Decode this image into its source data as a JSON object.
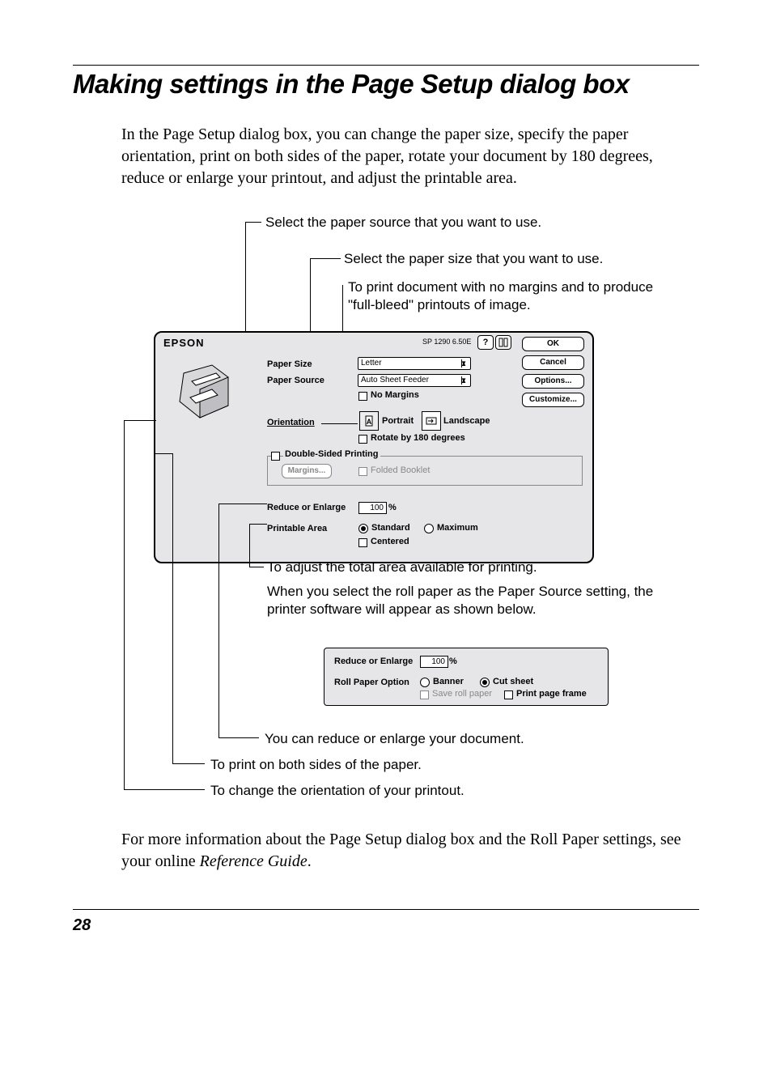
{
  "title": "Making settings in the Page Setup dialog box",
  "intro": "In the Page Setup dialog box, you can change the paper size, specify the paper orientation, print on both sides of the paper, rotate your document by 180 degrees, reduce or enlarge your printout, and adjust the printable area.",
  "callouts": {
    "source": "Select the paper source that you want to use.",
    "size": "Select the paper size that you want to use.",
    "nomargins": "To print document with no margins and to produce \"full-bleed\" printouts of image.",
    "printarea": "To adjust the total area available for printing.",
    "rollnote": "When you select the roll paper as the Paper Source setting, the printer software will appear as shown below.",
    "reduce": "You can reduce or enlarge your document.",
    "duplex": "To print on both sides of the paper.",
    "orient": "To change the orientation of your printout."
  },
  "dlg1": {
    "brand": "EPSON",
    "model": "SP 1290 6.50E",
    "labels": {
      "paper_size": "Paper Size",
      "paper_source": "Paper Source",
      "no_margins": "No Margins",
      "orientation": "Orientation",
      "portrait": "Portrait",
      "landscape": "Landscape",
      "rotate": "Rotate by 180 degrees",
      "double_sided": "Double-Sided Printing",
      "margins_btn": "Margins...",
      "folded": "Folded Booklet",
      "reduce": "Reduce or Enlarge",
      "percent": "100",
      "percent_sym": "%",
      "print_area": "Printable Area",
      "standard": "Standard",
      "maximum": "Maximum",
      "centered": "Centered"
    },
    "selects": {
      "size": "Letter",
      "source": "Auto Sheet Feeder"
    },
    "buttons": {
      "ok": "OK",
      "cancel": "Cancel",
      "options": "Options...",
      "customize": "Customize..."
    }
  },
  "dlg2": {
    "labels": {
      "reduce": "Reduce or Enlarge",
      "percent": "100",
      "percent_sym": "%",
      "roll_opt": "Roll Paper Option",
      "banner": "Banner",
      "cut": "Cut sheet",
      "save": "Save roll paper",
      "frame": "Print page frame"
    }
  },
  "footer": {
    "text_a": "For more information about the Page Setup dialog box and the Roll Paper settings, see your online ",
    "ref": "Reference Guide",
    "text_b": "."
  },
  "page_number": "28"
}
